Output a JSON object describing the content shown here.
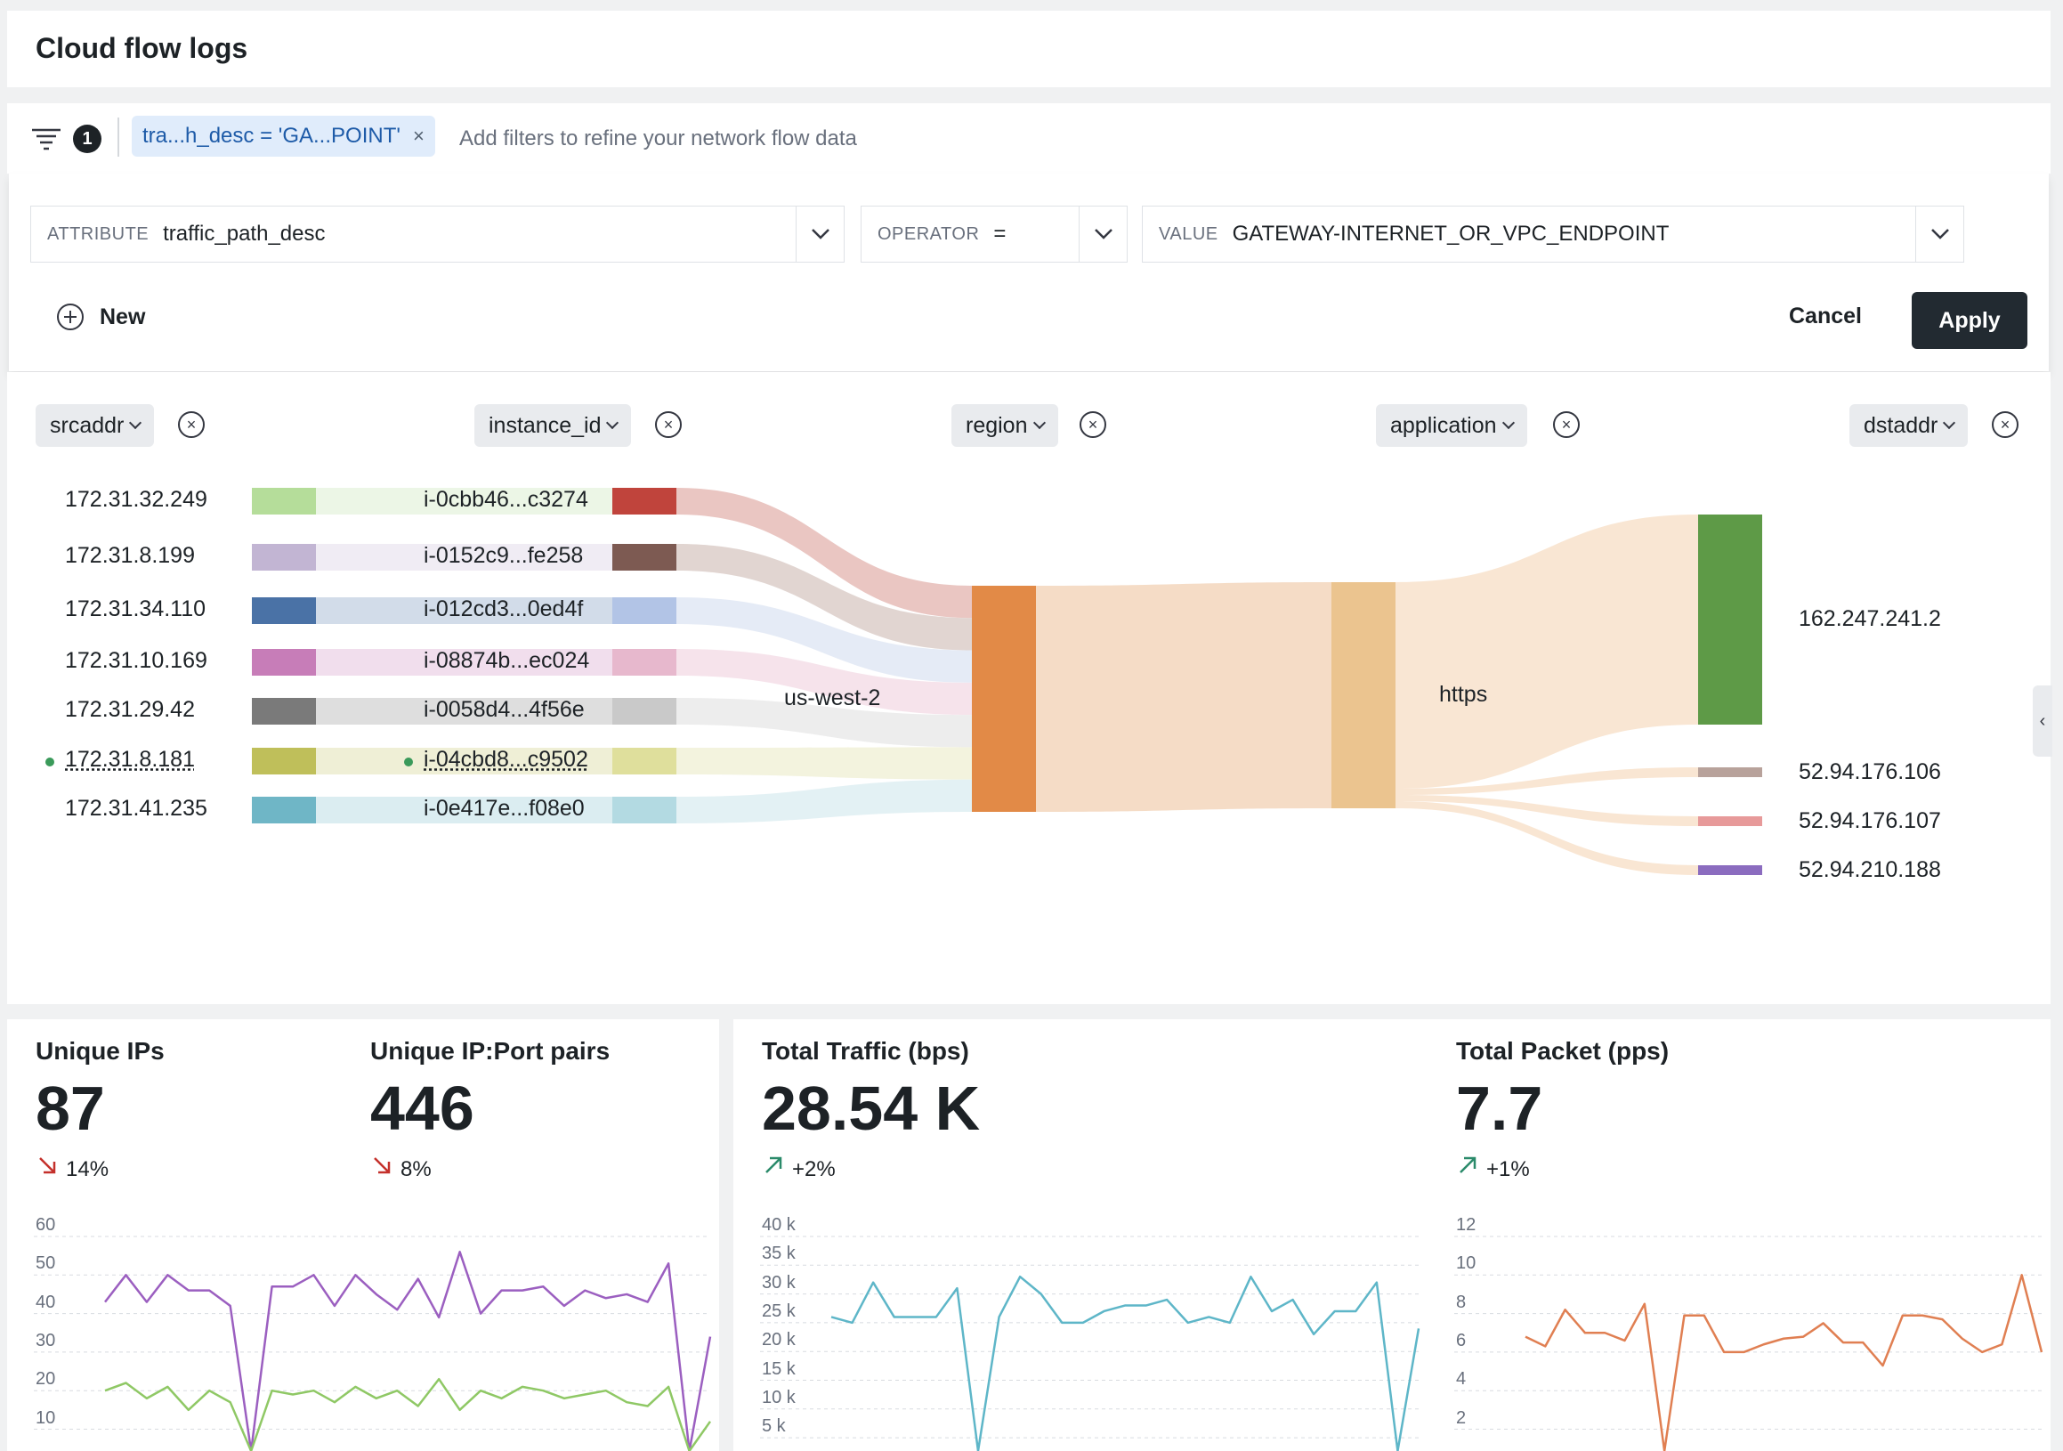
{
  "header": {
    "title": "Cloud flow logs"
  },
  "filter_bar": {
    "count": "1",
    "chip_label": "tra...h_desc = 'GA...POINT'",
    "chip_close": "×",
    "placeholder": "Add filters to refine your network flow data"
  },
  "editor": {
    "attribute_label": "ATTRIBUTE",
    "attribute_value": "traffic_path_desc",
    "operator_label": "OPERATOR",
    "operator_value": "=",
    "value_label": "VALUE",
    "value_value": "GATEWAY-INTERNET_OR_VPC_ENDPOINT",
    "new_label": "New",
    "cancel_label": "Cancel",
    "apply_label": "Apply"
  },
  "sankey": {
    "columns": [
      "srcaddr",
      "instance_id",
      "region",
      "application",
      "dstaddr"
    ],
    "sources": [
      {
        "addr": "172.31.32.249",
        "instance": "i-0cbb46...c3274",
        "color": "#b5dd9a",
        "inst_color": "#c0443c",
        "flow_color": "#e9c3bf"
      },
      {
        "addr": "172.31.8.199",
        "instance": "i-0152c9...fe258",
        "color": "#c2b5d3",
        "inst_color": "#7d5a52",
        "flow_color": "#dfd3cf"
      },
      {
        "addr": "172.31.34.110",
        "instance": "i-012cd3...0ed4f",
        "color": "#4a72a6",
        "inst_color": "#b2c4e6",
        "flow_color": "#e4eaf5"
      },
      {
        "addr": "172.31.10.169",
        "instance": "i-08874b...ec024",
        "color": "#c77db8",
        "inst_color": "#e7b8cd",
        "flow_color": "#f5e2ea"
      },
      {
        "addr": "172.31.29.42",
        "instance": "i-0058d4...4f56e",
        "color": "#7a7a7a",
        "inst_color": "#c9c9c9",
        "flow_color": "#ececec"
      },
      {
        "addr": "172.31.8.181",
        "instance": "i-04cbd8...c9502",
        "color": "#bfbf5a",
        "inst_color": "#dfdf9c",
        "flow_color": "#f2f2dc"
      },
      {
        "addr": "172.31.41.235",
        "instance": "i-0e417e...f08e0",
        "color": "#6fb6c6",
        "inst_color": "#b3dae2",
        "flow_color": "#e2f0f3"
      }
    ],
    "region": "us-west-2",
    "region_color": "#e28a47",
    "application": "https",
    "application_color": "#ebc48f",
    "destinations": [
      {
        "addr": "162.247.241.2",
        "color": "#5e9a47"
      },
      {
        "addr": "52.94.176.106",
        "color": "#b8a29b"
      },
      {
        "addr": "52.94.176.107",
        "color": "#e79a9a"
      },
      {
        "addr": "52.94.210.188",
        "color": "#8b6cbf"
      }
    ]
  },
  "metrics": {
    "unique_ips": {
      "label": "Unique IPs",
      "value": "87",
      "trend": "14%"
    },
    "unique_pairs": {
      "label": "Unique IP:Port pairs",
      "value": "446",
      "trend": "8%"
    },
    "total_traffic": {
      "label": "Total Traffic (bps)",
      "value": "28.54 K",
      "trend": "+2%"
    },
    "total_packet": {
      "label": "Total Packet (pps)",
      "value": "7.7",
      "trend": "+1%"
    }
  },
  "chart_data": [
    {
      "type": "line",
      "yticks": [
        "60",
        "50",
        "40",
        "30",
        "20",
        "10"
      ],
      "ylim": [
        0,
        60
      ],
      "series": [
        {
          "color": "#9b5fc0",
          "values": [
            43,
            50,
            43,
            50,
            46,
            46,
            42,
            0,
            47,
            47,
            50,
            42,
            50,
            45,
            41,
            49,
            39,
            56,
            40,
            46,
            46,
            47,
            42,
            46,
            44,
            45,
            43,
            53,
            0,
            34
          ]
        },
        {
          "color": "#8fc865",
          "values": [
            20,
            22,
            18,
            21,
            15,
            20,
            17,
            0,
            20,
            19,
            20,
            17,
            21,
            18,
            20,
            16,
            23,
            15,
            20,
            18,
            21,
            20,
            18,
            19,
            20,
            17,
            16,
            21,
            0,
            12
          ]
        }
      ]
    },
    {
      "type": "line",
      "yticks": [
        "40 k",
        "35 k",
        "30 k",
        "25 k",
        "20 k",
        "15 k",
        "10 k",
        "5 k"
      ],
      "ylim": [
        0,
        40
      ],
      "series": [
        {
          "color": "#5eb6c8",
          "values": [
            26,
            25,
            32,
            26,
            26,
            26,
            31,
            0,
            26,
            33,
            30,
            25,
            25,
            27,
            28,
            28,
            29,
            25,
            26,
            25,
            33,
            27,
            29,
            23,
            27,
            27,
            32,
            0,
            24
          ]
        }
      ]
    },
    {
      "type": "line",
      "yticks": [
        "12",
        "10",
        "8",
        "6",
        "4",
        "2"
      ],
      "ylim": [
        0,
        12
      ],
      "series": [
        {
          "color": "#e07f52",
          "values": [
            6.8,
            6.3,
            8.2,
            7.0,
            7.0,
            6.6,
            8.5,
            0,
            7.9,
            7.9,
            6.0,
            6.0,
            6.4,
            6.7,
            6.8,
            7.5,
            6.5,
            6.5,
            5.3,
            7.9,
            7.9,
            7.7,
            6.7,
            6.0,
            6.4,
            10.0,
            6.0
          ]
        }
      ]
    }
  ]
}
